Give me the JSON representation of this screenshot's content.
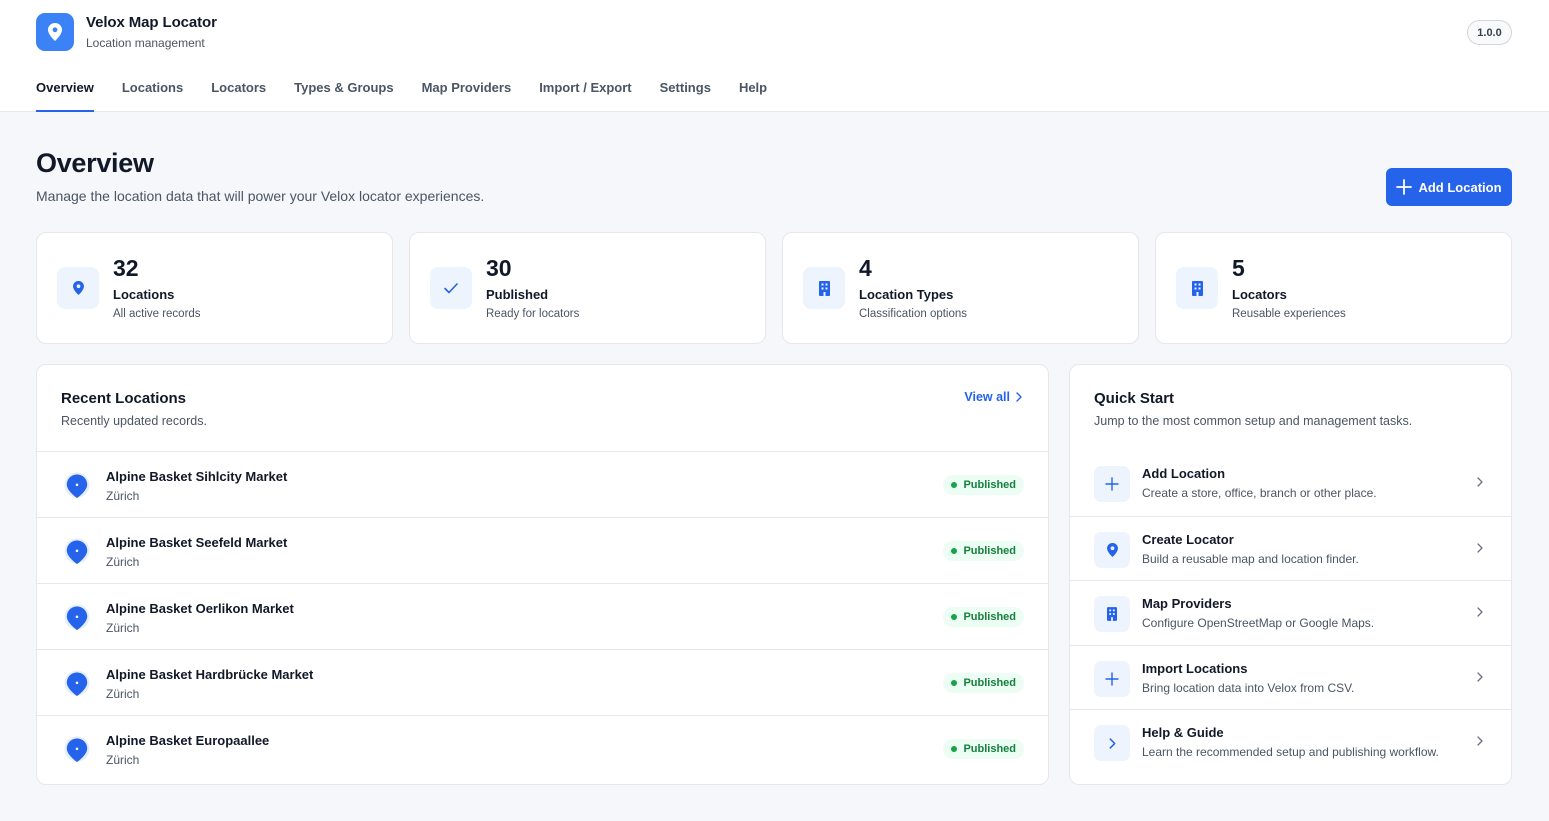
{
  "app": {
    "title": "Velox Map Locator",
    "subtitle": "Location management",
    "version": "1.0.0",
    "accent": "#2563eb"
  },
  "nav": {
    "tabs": [
      {
        "label": "Overview",
        "active": true
      },
      {
        "label": "Locations"
      },
      {
        "label": "Locators"
      },
      {
        "label": "Types & Groups"
      },
      {
        "label": "Map Providers"
      },
      {
        "label": "Import / Export"
      },
      {
        "label": "Settings"
      },
      {
        "label": "Help"
      }
    ]
  },
  "header": {
    "title": "Overview",
    "subtitle": "Manage the location data that will power your Velox locator experiences.",
    "add_button": "Add Location"
  },
  "stats": [
    {
      "value": "32",
      "label": "Locations",
      "desc": "All active records",
      "icon": "map-pin-icon"
    },
    {
      "value": "30",
      "label": "Published",
      "desc": "Ready for locators",
      "icon": "check-icon"
    },
    {
      "value": "4",
      "label": "Location Types",
      "desc": "Classification options",
      "icon": "building-icon"
    },
    {
      "value": "5",
      "label": "Locators",
      "desc": "Reusable experiences",
      "icon": "building-icon"
    }
  ],
  "recent": {
    "title": "Recent Locations",
    "subtitle": "Recently updated records.",
    "view_all": "View all",
    "items": [
      {
        "name": "Alpine Basket Sihlcity Market",
        "city": "Zürich",
        "status": "Published"
      },
      {
        "name": "Alpine Basket Seefeld Market",
        "city": "Zürich",
        "status": "Published"
      },
      {
        "name": "Alpine Basket Oerlikon Market",
        "city": "Zürich",
        "status": "Published"
      },
      {
        "name": "Alpine Basket Hardbrücke Market",
        "city": "Zürich",
        "status": "Published"
      },
      {
        "name": "Alpine Basket Europaallee",
        "city": "Zürich",
        "status": "Published"
      }
    ]
  },
  "quick_start": {
    "title": "Quick Start",
    "subtitle": "Jump to the most common setup and management tasks.",
    "items": [
      {
        "title": "Add Location",
        "desc": "Create a store, office, branch or other place.",
        "icon": "plus-icon"
      },
      {
        "title": "Create Locator",
        "desc": "Build a reusable map and location finder.",
        "icon": "map-pin-icon"
      },
      {
        "title": "Map Providers",
        "desc": "Configure OpenStreetMap or Google Maps.",
        "icon": "building-icon"
      },
      {
        "title": "Import Locations",
        "desc": "Bring location data into Velox from CSV.",
        "icon": "plus-icon"
      },
      {
        "title": "Help & Guide",
        "desc": "Learn the recommended setup and publishing workflow.",
        "icon": "chevron-right-icon"
      }
    ]
  }
}
